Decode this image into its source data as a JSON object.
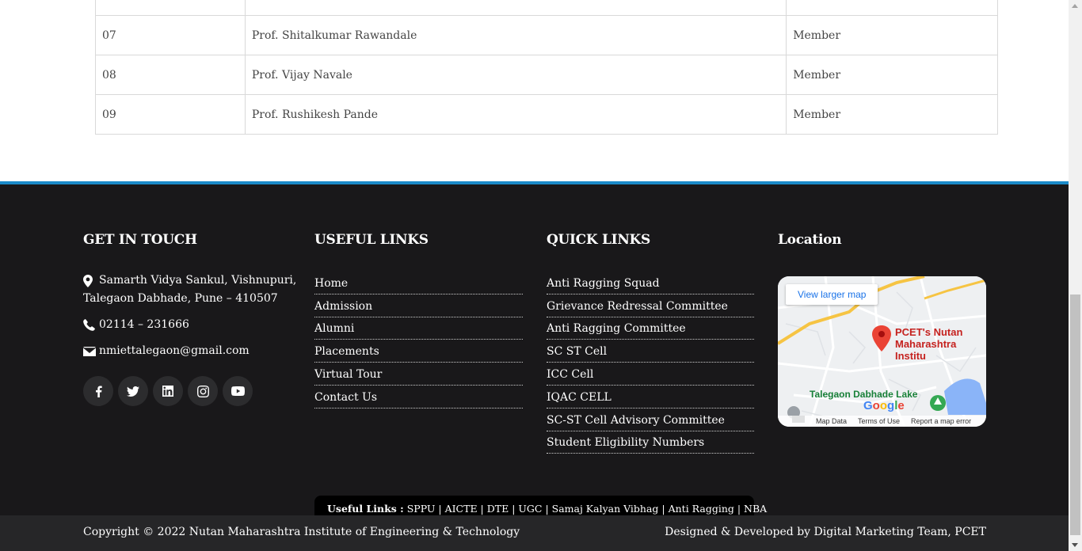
{
  "committee_table": {
    "rows": [
      {
        "no": "",
        "name": "",
        "role": ""
      },
      {
        "no": "07",
        "name": "Prof. Shitalkumar Rawandale",
        "role": "Member"
      },
      {
        "no": "08",
        "name": "Prof. Vijay Navale",
        "role": "Member"
      },
      {
        "no": "09",
        "name": "Prof. Rushikesh Pande",
        "role": "Member"
      }
    ]
  },
  "footer": {
    "get_in_touch": {
      "heading": "GET IN TOUCH",
      "address_line1": "Samarth Vidya Sankul, Vishnupuri,",
      "address_line2": "Talegaon Dabhade, Pune – 410507",
      "phone": "02114 – 231666",
      "email": "nmiettalegaon@gmail.com",
      "social_icons": [
        "facebook-icon",
        "twitter-icon",
        "linkedin-icon",
        "instagram-icon",
        "youtube-icon"
      ]
    },
    "useful_links": {
      "heading": "USEFUL LINKS",
      "items": [
        "Home",
        "Admission",
        "Alumni",
        "Placements",
        "Virtual Tour",
        "Contact Us"
      ]
    },
    "quick_links": {
      "heading": "QUICK LINKS",
      "items": [
        "Anti Ragging Squad",
        "Grievance Redressal Committee",
        "Anti Ragging Committee",
        "SC ST Cell",
        "ICC Cell",
        "IQAC CELL",
        "SC-ST Cell Advisory Committee",
        "Student Eligibility Numbers"
      ]
    },
    "location": {
      "heading": "Location",
      "map_button": "View larger map",
      "place_line1": "PCET's Nutan",
      "place_line2": "Maharashtra Institu",
      "lake_label": "Talegaon Dabhade Lake",
      "google": "Google",
      "map_data": "Map Data",
      "terms": "Terms of Use",
      "report": "Report a map error"
    },
    "useful_bar": {
      "label": "Useful Links :",
      "links": "SPPU | AICTE | DTE | UGC | Samaj Kalyan Vibhag | Anti Ragging | NBA"
    },
    "copyright": "Copyright © 2022 Nutan Maharashtra Institute of Engineering & Technology",
    "credit": "Designed & Developed by Digital Marketing Team, PCET"
  },
  "colors": {
    "footer_bg": "#19181a",
    "accent_border": "#1b8ac9",
    "copyright_bg": "#262628"
  }
}
